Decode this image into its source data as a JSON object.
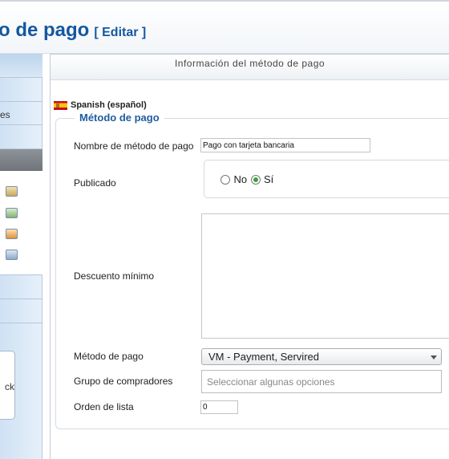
{
  "header": {
    "title": "o de pago",
    "edit_label": "[ Editar ]"
  },
  "sidebar": {
    "partial_item_label": "es",
    "box_partial_label": "ck",
    "icons": [
      "store-icon",
      "copy-icon",
      "truck-icon",
      "card-icon"
    ]
  },
  "panel": {
    "heading": "Información del método de pago",
    "language": "Spanish (español)",
    "legend": "Método de pago",
    "fields": {
      "name_label": "Nombre de método de pago",
      "name_value": "Pago con tarjeta bancaria",
      "published_label": "Publicado",
      "published_no": "No",
      "published_yes": "Sí",
      "published_selected": "Sí",
      "discount_label": "Descuento mínimo",
      "discount_value": "",
      "method_label": "Método de pago",
      "method_value": "VM - Payment, Servired",
      "group_label": "Grupo de compradores",
      "group_placeholder": "Seleccionar algunas opciones",
      "order_label": "Orden de lista",
      "order_value": "0"
    }
  },
  "colors": {
    "brand_blue": "#14589f",
    "legend_blue": "#1f5d9e",
    "radio_selected": "#3aa435"
  }
}
